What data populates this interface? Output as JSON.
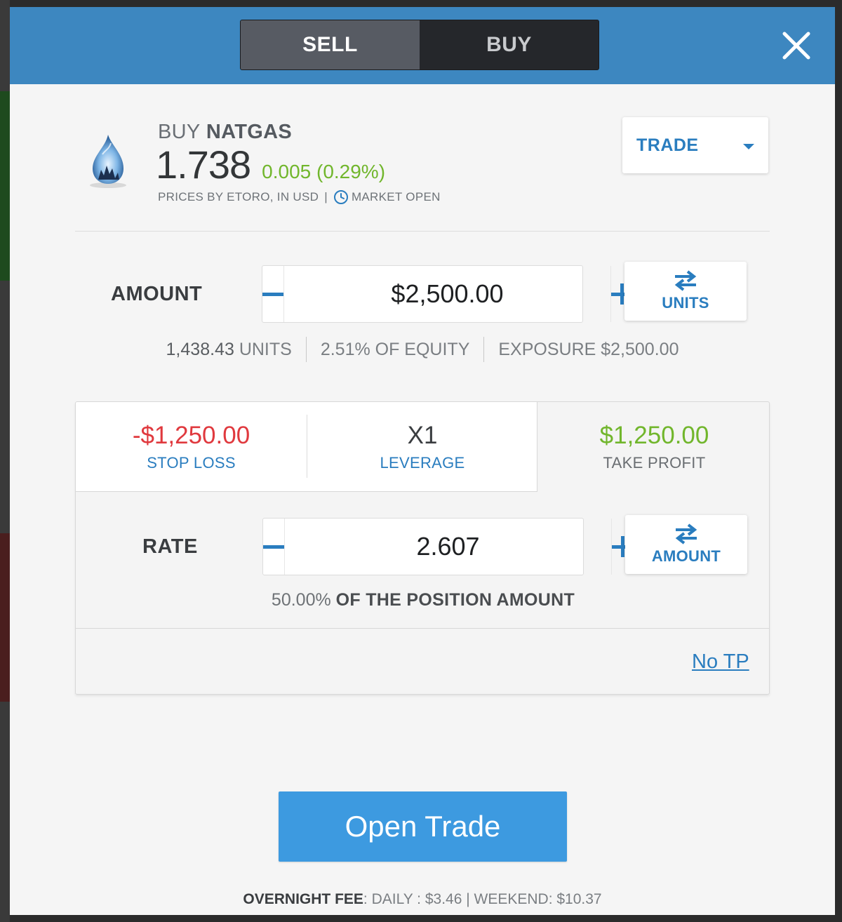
{
  "header": {
    "sell_label": "SELL",
    "buy_label": "BUY",
    "active_tab": "sell"
  },
  "instrument": {
    "action": "BUY",
    "symbol": "NATGAS",
    "price": "1.738",
    "change": "0.005 (0.29%)",
    "source": "PRICES BY ETORO, IN USD",
    "separator": "|",
    "market_status": "MARKET OPEN",
    "icon": "gas-flame-icon"
  },
  "trade_dropdown": {
    "label": "TRADE"
  },
  "amount": {
    "label": "AMOUNT",
    "value": "$2,500.00",
    "swap_label": "UNITS",
    "units_num": "1,438.43",
    "units_label": "UNITS",
    "equity": "2.51% OF EQUITY",
    "exposure": "EXPOSURE $2,500.00"
  },
  "tabs": {
    "stop_loss_value": "-$1,250.00",
    "stop_loss_label": "STOP LOSS",
    "leverage_value": "X1",
    "leverage_label": "LEVERAGE",
    "take_profit_value": "$1,250.00",
    "take_profit_label": "TAKE PROFIT",
    "active": "take_profit"
  },
  "rate": {
    "label": "RATE",
    "value": "2.607",
    "swap_label": "AMOUNT",
    "note_pct": "50.00%",
    "note_text": "OF THE POSITION AMOUNT",
    "no_tp_link": "No TP"
  },
  "open_trade_label": "Open Trade",
  "fee": {
    "label": "OVERNIGHT FEE",
    "text": ": DAILY : $3.46 | WEEKEND: $10.37"
  },
  "colors": {
    "header_bg": "#3d87c0",
    "accent_blue": "#2a7dbf",
    "profit_green": "#71b62c",
    "loss_red": "#e0393e",
    "open_trade_bg": "#3d9ae0"
  }
}
